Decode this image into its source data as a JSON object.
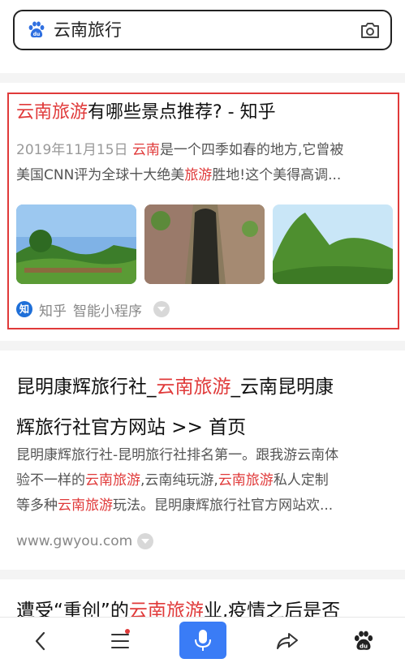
{
  "search": {
    "query": "云南旅行"
  },
  "result1": {
    "title_highlight": "云南旅游",
    "title_rest": "有哪些景点推荐? - 知乎",
    "date": "2019年11月15日",
    "snippet_l1_hl": "云南",
    "snippet_l1_rest": "是一个四季如春的地方,它曾被",
    "snippet_l2_pre": "美国CNN评为全球十大绝美",
    "snippet_l2_hl": "旅游",
    "snippet_l2_rest": "胜地!这个美得高调...",
    "source_icon": "知",
    "source_name": "知乎",
    "source_tag": "智能小程序"
  },
  "result2": {
    "title_l1_pre": "昆明康辉旅行社_",
    "title_l1_hl": "云南旅游",
    "title_l1_rest": "_云南昆明康",
    "title_l2": "辉旅行社官方网站 >> 首页",
    "snippet_l1": "昆明康辉旅行社-昆明旅行社排名第一。跟我游云南体",
    "snippet_l2_pre": "验不一样的",
    "snippet_l2_hl1": "云南旅游",
    "snippet_l2_mid": ",云南纯玩游,",
    "snippet_l2_hl2": "云南旅游",
    "snippet_l2_rest": "私人定制",
    "snippet_l3_pre": "等多种",
    "snippet_l3_hl": "云南旅游",
    "snippet_l3_rest": "玩法。昆明康辉旅行社官方网站欢...",
    "url": "www.gwyou.com"
  },
  "result3": {
    "title_pre": "遭受“重创”的",
    "title_hl": "云南旅游",
    "title_rest": "业,疫情之后是否"
  },
  "colors": {
    "highlight": "#e03a3a",
    "accent": "#3a7cf6",
    "frame": "#e03a3a"
  },
  "bottom_nav": [
    "back-icon",
    "menu-icon",
    "microphone-icon",
    "share-icon",
    "baidu-paw-icon"
  ]
}
